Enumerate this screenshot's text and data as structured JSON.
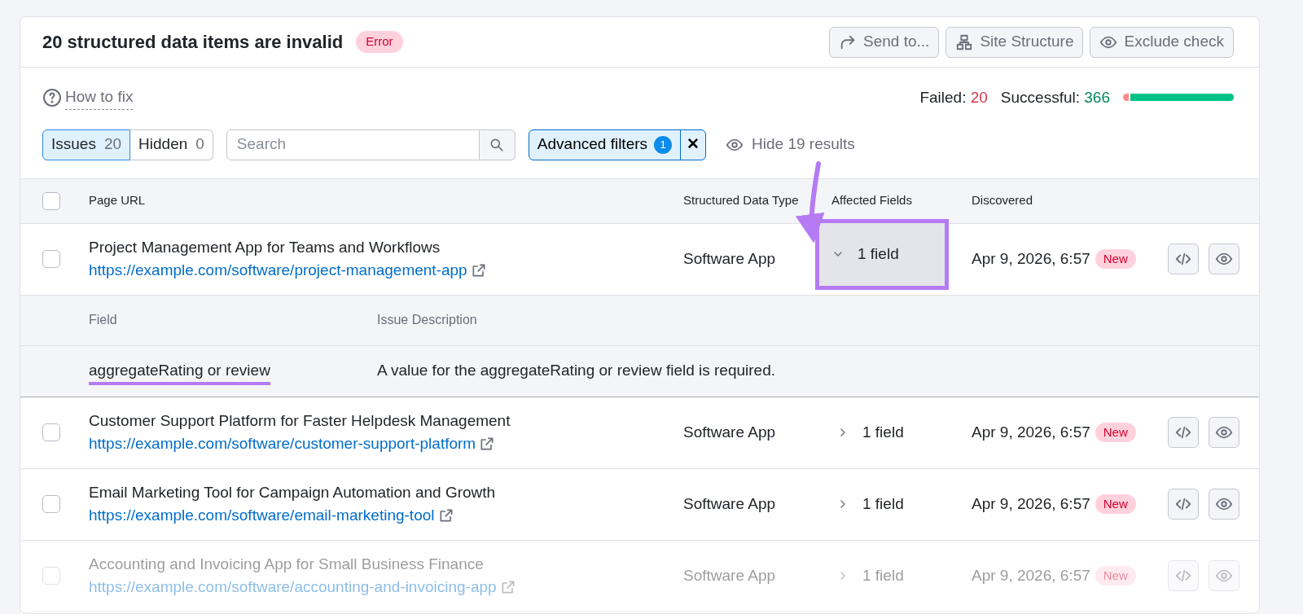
{
  "header": {
    "title": "20 structured data items are invalid",
    "badge": "Error",
    "buttons": [
      {
        "label": "Send to..."
      },
      {
        "label": "Site Structure"
      },
      {
        "label": "Exclude check"
      }
    ]
  },
  "help_link": "How to fix",
  "stats": {
    "failed_label": "Failed:",
    "failed": "20",
    "successful_label": "Successful:",
    "successful": "366",
    "level": 0.948
  },
  "tabs": [
    {
      "label": "Issues",
      "count": "20",
      "selected": true
    },
    {
      "label": "Hidden",
      "count": "0",
      "selected": false
    }
  ],
  "search": {
    "placeholder": "Search"
  },
  "advanced_filters": {
    "label": "Advanced filters",
    "count": "1",
    "clear": "✕"
  },
  "hide_results": "Hide 19 results",
  "table": {
    "select_all": {
      "checked": false
    },
    "columns": [
      "Page URL",
      "Structured Data Type",
      "Affected Fields",
      "Discovered"
    ],
    "rows": [
      {
        "title": "Project Management App for Teams and Workflows",
        "url": "https://example.com/software/project-management-app",
        "type": "Software App",
        "fields": "1 field",
        "expanded": true,
        "highlighted": true,
        "discovered": "Apr 9, 2026, 6:57",
        "badge": "New",
        "checked": false,
        "dimmed": false,
        "details": {
          "columns": [
            "Field",
            "Issue Description"
          ],
          "rows": [
            {
              "field": "aggregateRating or review",
              "description": "A value for the aggregateRating or review field is required.",
              "underlined": true
            }
          ]
        }
      },
      {
        "title": "Customer Support Platform for Faster Helpdesk Management",
        "url": "https://example.com/software/customer-support-platform",
        "type": "Software App",
        "fields": "1 field",
        "expanded": false,
        "highlighted": false,
        "discovered": "Apr 9, 2026, 6:57",
        "badge": "New",
        "checked": false,
        "dimmed": false
      },
      {
        "title": "Email Marketing Tool for Campaign Automation and Growth",
        "url": "https://example.com/software/email-marketing-tool",
        "type": "Software App",
        "fields": "1 field",
        "expanded": false,
        "highlighted": false,
        "discovered": "Apr 9, 2026, 6:57",
        "badge": "New",
        "checked": false,
        "dimmed": false
      },
      {
        "title": "Accounting and Invoicing App for Small Business Finance",
        "url": "https://example.com/software/accounting-and-invoicing-app",
        "type": "Software App",
        "fields": "1 field",
        "expanded": false,
        "highlighted": false,
        "discovered": "Apr 9, 2026, 6:57",
        "badge": "New",
        "checked": false,
        "dimmed": true
      }
    ]
  }
}
